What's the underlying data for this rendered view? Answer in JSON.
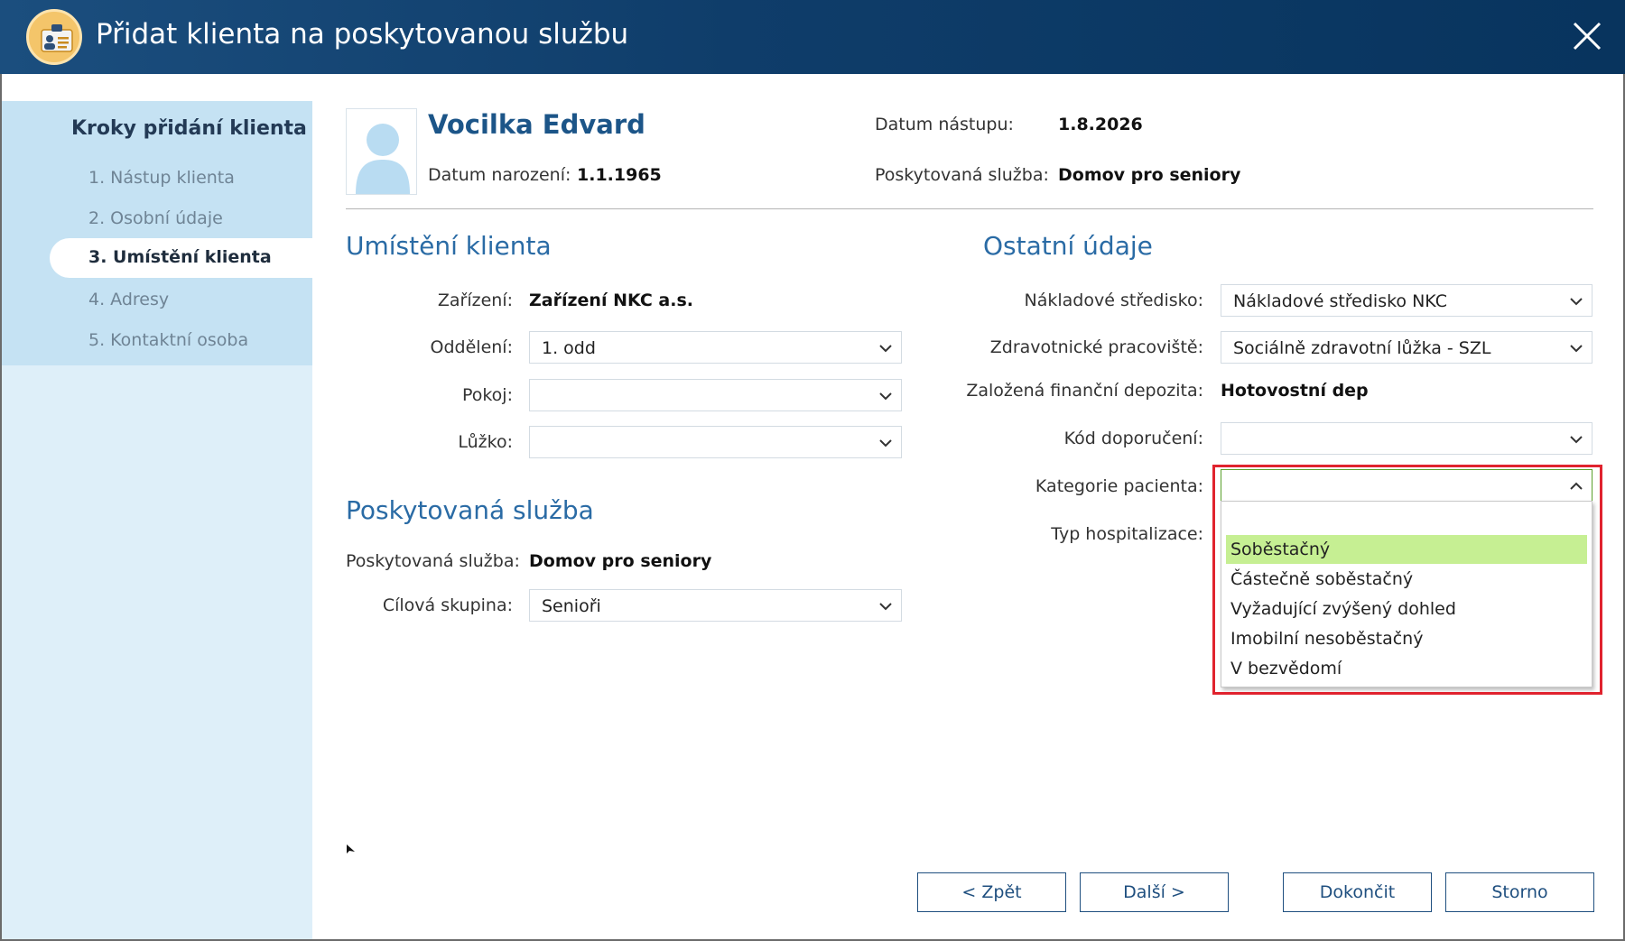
{
  "window": {
    "title": "Přidat klienta na poskytovanou službu"
  },
  "sidebar": {
    "title": "Kroky přidání klienta",
    "steps": [
      {
        "label": "1. Nástup klienta"
      },
      {
        "label": "2. Osobní údaje"
      },
      {
        "label": "3. Umístění klienta"
      },
      {
        "label": "4. Adresy"
      },
      {
        "label": "5. Kontaktní osoba"
      }
    ],
    "active_step": "3. Umístění klienta"
  },
  "header": {
    "client_name": "Vocilka Edvard",
    "birth_label": "Datum narození:",
    "birth_value": "1.1.1965",
    "start_label": "Datum nástupu:",
    "start_value": "1.8.2026",
    "service_label": "Poskytovaná služba:",
    "service_value": "Domov pro seniory"
  },
  "placement": {
    "section_title": "Umístění klienta",
    "facility_label": "Zařízení:",
    "facility_value": "Zařízení NKC a.s.",
    "department_label": "Oddělení:",
    "department_value": "1. odd",
    "room_label": "Pokoj:",
    "room_value": "",
    "bed_label": "Lůžko:",
    "bed_value": ""
  },
  "service": {
    "section_title": "Poskytovaná služba",
    "service_label": "Poskytovaná služba:",
    "service_value": "Domov pro seniory",
    "target_label": "Cílová skupina:",
    "target_value": "Senioři"
  },
  "other": {
    "section_title": "Ostatní údaje",
    "cost_center_label": "Nákladové středisko:",
    "cost_center_value": "Nákladové středisko NKC",
    "workplace_label": "Zdravotnické pracoviště:",
    "workplace_value": "Sociálně zdravotní lůžka - SZL",
    "deposit_label": "Založená finanční depozita:",
    "deposit_value": "Hotovostní dep",
    "referral_label": "Kód doporučení:",
    "referral_value": "",
    "category_label": "Kategorie pacienta:",
    "category_value": "",
    "hospitalization_label": "Typ hospitalizace:",
    "category_options": [
      "Soběstačný",
      "Částečně soběstačný",
      "Vyžadující zvýšený dohled",
      "Imobilní nesoběstačný",
      "V bezvědomí"
    ],
    "category_highlighted": "Soběstačný"
  },
  "buttons": {
    "back": "< Zpět",
    "next": "Další >",
    "finish": "Dokončit",
    "cancel": "Storno"
  },
  "colors": {
    "title_bar": "#0f3d6a",
    "accent": "#2a6ba5",
    "sidebar": "#c5e2f3",
    "highlight_option": "#c6ef93",
    "annotation_box": "#e0232e"
  }
}
